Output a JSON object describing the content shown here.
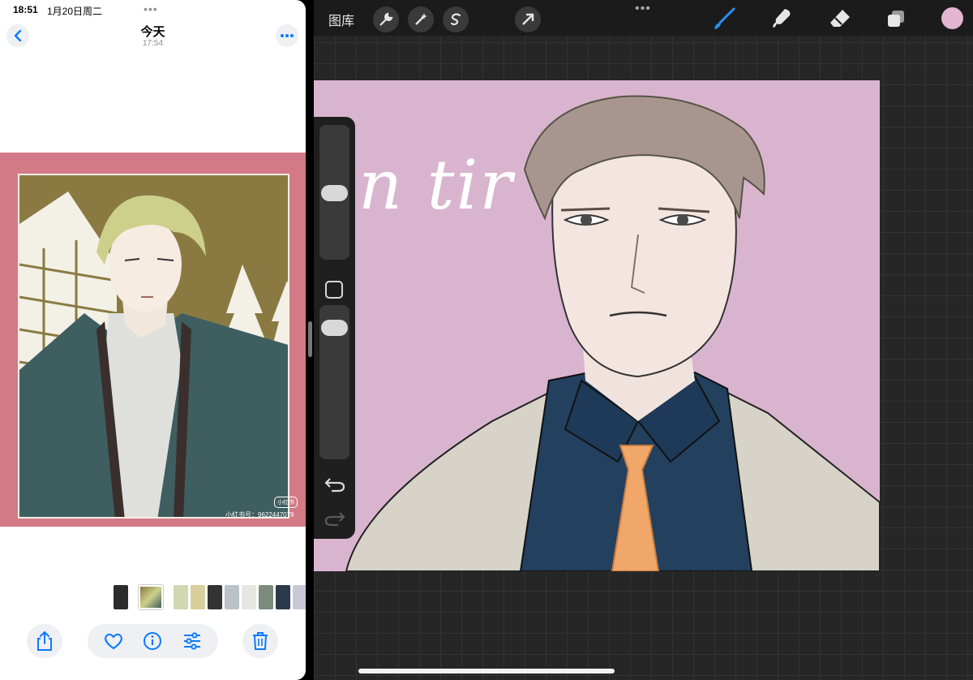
{
  "status": {
    "time": "18:51",
    "date": "1月20日周二"
  },
  "photos": {
    "title": "今天",
    "subtitle": "17:54",
    "watermark_badge": "小红书",
    "watermark_id": "小红书号：9622447079",
    "thumbnails": [
      "#2c2c2c",
      "#9aa6a0",
      "#cfd8b0",
      "#d9cf9a",
      "#333333",
      "#b9c2c8",
      "#7c8c7c",
      "#2b3a4a",
      "#c8c8d8"
    ],
    "accent": "#0a7aff"
  },
  "procreate": {
    "gallery_label": "图库",
    "canvas_text": "n tir",
    "current_color": "#e2b5d0",
    "canvas_bg": "#d9b4cf"
  },
  "icons": [
    "chevron-left-icon",
    "more-icon",
    "share-icon",
    "heart-icon",
    "info-icon",
    "sliders-icon",
    "trash-icon",
    "wrench-icon",
    "magic-wand-icon",
    "selection-icon",
    "transform-arrow-icon",
    "brush-icon",
    "smudge-icon",
    "eraser-icon",
    "layers-icon",
    "undo-icon",
    "redo-icon"
  ]
}
